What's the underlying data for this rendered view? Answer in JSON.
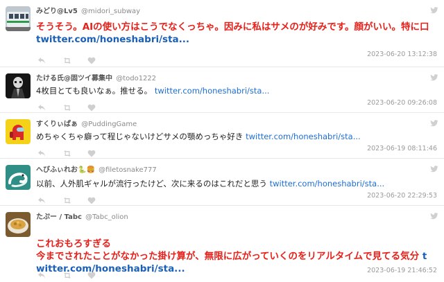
{
  "tweets": [
    {
      "name": "みどり@Lv5",
      "handle": "@midori_subway",
      "text": "そうそう。AIの使い方はこうでなくっちゃ。因みに私はサメのが好みです。顔がいい。特に口 ",
      "link": "twitter.com/honeshabri/sta...",
      "time": "2023-06-20 13:12:38",
      "avatar": "train-avatar"
    },
    {
      "name": "たける氏@固ツイ募集中",
      "handle": "@todo1222",
      "text": "4枚目とても良いなぁ。推せる。 ",
      "link": "twitter.com/honeshabri/sta...",
      "time": "2023-06-20 09:26:08",
      "avatar": "dark-figure-avatar"
    },
    {
      "name": "すくりぃぱぁ",
      "handle": "@PuddingGame",
      "text": "めちゃくちゃ癖って程じゃないけどサメの顎めっちゃ好き ",
      "link": "twitter.com/honeshabri/sta...",
      "time": "2023-06-19 08:11:46",
      "avatar": "crewmate-avatar"
    },
    {
      "name": "へびふぃれお🐍🍔",
      "handle": "@filetosnake777",
      "text": "以前、人外肌ギャルが流行ったけど、次に来るのはこれだと思う ",
      "link": "twitter.com/honeshabri/sta...",
      "time": "2023-06-20 22:29:53",
      "avatar": "snake-avatar"
    },
    {
      "name": "たぷー / Tabc",
      "handle": "@Tabc_olion",
      "text": "これおもろすぎる\n今までされたことがなかった掛け算が、無限に広がっていくのをリアルタイムで見てる気分 ",
      "link": "twitter.com/honeshabri/sta...",
      "time": "2023-06-19 21:46:52",
      "avatar": "food-avatar"
    }
  ],
  "colors": {
    "highlight_text": "#e8201a",
    "link": "#1b6ed6",
    "meta": "#9a9a9a"
  }
}
